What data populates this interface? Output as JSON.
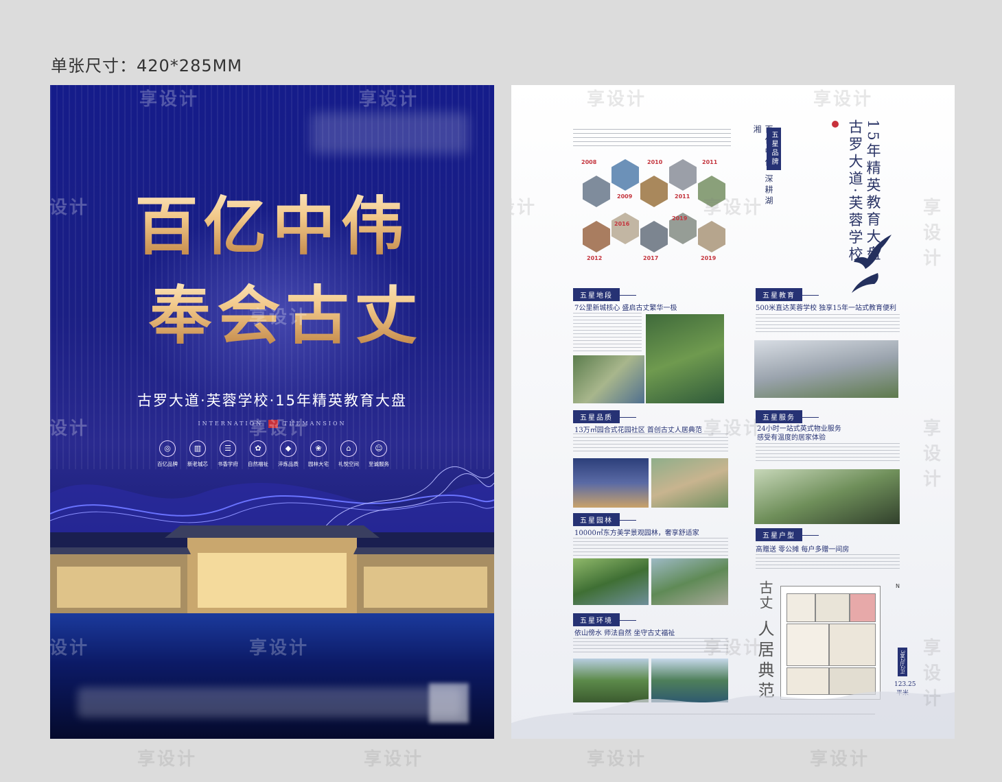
{
  "header": {
    "size_label": "单张尺寸：420*285MM"
  },
  "front": {
    "headline_line1": "百亿中伟",
    "headline_line2": "奉会古丈",
    "subtitle": "古罗大道·芙蓉学校·15年精英教育大盘",
    "brand_left": "INTERNATION",
    "brand_right": "THEMANSION",
    "features": [
      {
        "icon": "brand-icon",
        "glyph": "◎",
        "label": "百亿品牌"
      },
      {
        "icon": "building-icon",
        "glyph": "▥",
        "label": "新老城芯"
      },
      {
        "icon": "book-icon",
        "glyph": "☰",
        "label": "书香学府"
      },
      {
        "icon": "flower-icon",
        "glyph": "✿",
        "label": "自然福祉"
      },
      {
        "icon": "diamond-icon",
        "glyph": "◆",
        "label": "淬炼品质"
      },
      {
        "icon": "garden-icon",
        "glyph": "❀",
        "label": "园林大宅"
      },
      {
        "icon": "pavilion-icon",
        "glyph": "⌂",
        "label": "礼悦空间"
      },
      {
        "icon": "service-icon",
        "glyph": "☺",
        "label": "至诚服务"
      }
    ],
    "colors": {
      "bg": "#1b1f84",
      "gold": "#f2c98a"
    }
  },
  "back": {
    "vertical_slogan": "百亿中伟 深耕湖湘",
    "badge_brand": "五星品牌",
    "big_vertical_1": "15年精英教育大盘",
    "big_vertical_2": "古罗大道·芙蓉学校",
    "timeline": [
      {
        "year": "2008"
      },
      {
        "year": "2010"
      },
      {
        "year": "2011"
      },
      {
        "year": "2009"
      },
      {
        "year": "2011"
      },
      {
        "year": "2016"
      },
      {
        "year": "2019"
      },
      {
        "year": "2012"
      },
      {
        "year": "2017"
      },
      {
        "year": "2019"
      }
    ],
    "sections": {
      "location": {
        "tag": "五星地段",
        "title": "7公里新城核心 盛启古丈繁华一极"
      },
      "education": {
        "tag": "五星教育",
        "title": "500米直达芙蓉学校 独享15年一站式教育便利"
      },
      "quality": {
        "tag": "五星品质",
        "title": "13万㎡园合式花园社区 首创古丈人居典范"
      },
      "service": {
        "tag": "五星服务",
        "title_1": "24小时一站式英式物业服务",
        "title_2": "感受有温度的居家体验"
      },
      "garden": {
        "tag": "五星园林",
        "title": "10000㎡东方美学景观园林，奢享舒适家"
      },
      "unit": {
        "tag": "五星户型",
        "title": "高赠送 零公摊 每户多赠一间房"
      },
      "environment": {
        "tag": "五星环境",
        "title": "依山傍水 师法自然 坐守古丈福祉"
      }
    },
    "vertical_gz": "古丈",
    "vertical_rjdf": "人居典范",
    "unit_badge": "3室2厅2卫",
    "unit_area": "123.25",
    "unit_area_unit": "平米",
    "compass_label": "N"
  },
  "watermarks": [
    "享设计"
  ]
}
